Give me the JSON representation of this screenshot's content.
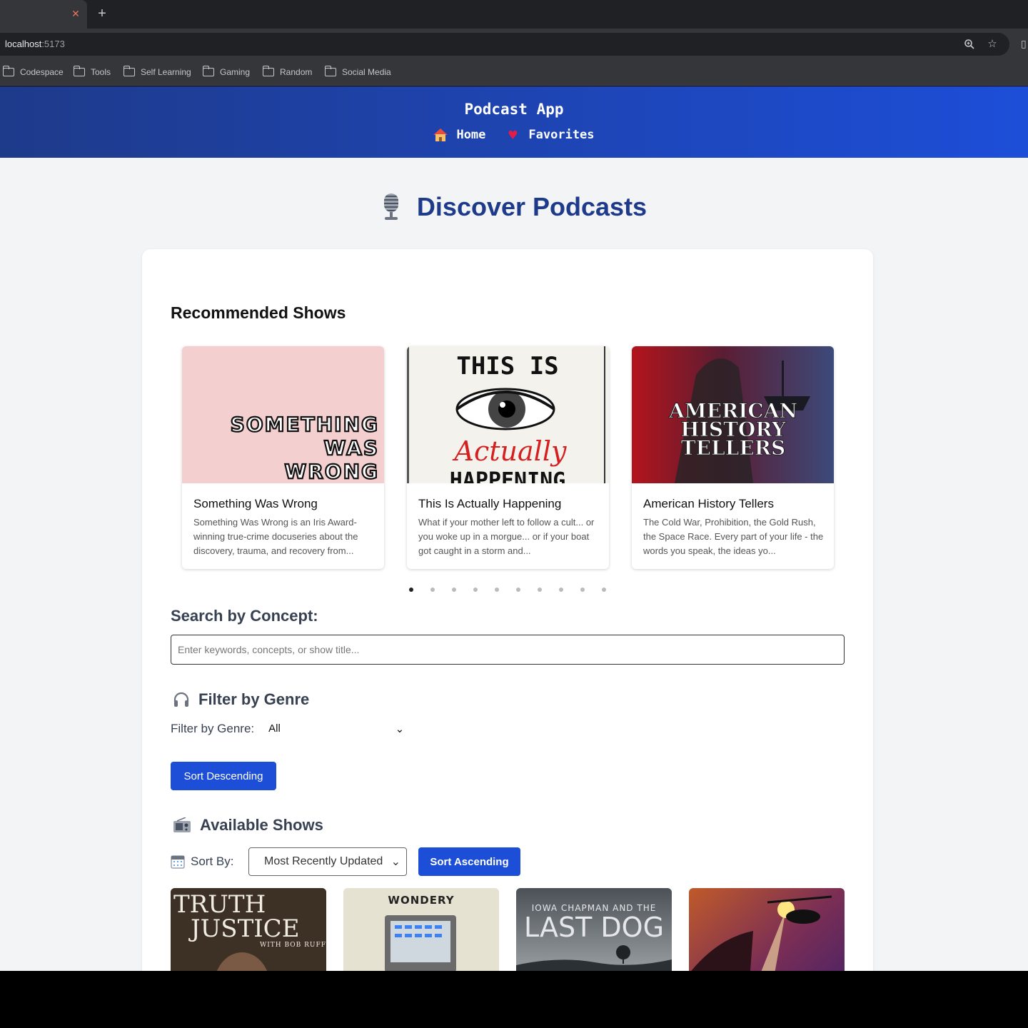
{
  "browser": {
    "url_host": "localhost",
    "url_port": ":5173",
    "bookmarks": [
      "Codespace",
      "Tools",
      "Self Learning",
      "Gaming",
      "Random",
      "Social Media"
    ]
  },
  "header": {
    "title": "Podcast App",
    "nav": [
      {
        "icon": "house-icon",
        "label": "Home"
      },
      {
        "icon": "heart-icon",
        "label": "Favorites"
      }
    ]
  },
  "page": {
    "title": "Discover Podcasts"
  },
  "recommended": {
    "heading": "Recommended Shows",
    "shows": [
      {
        "title": "Something Was Wrong",
        "description": "Something Was Wrong is an Iris Award-winning true-crime docuseries about the discovery, trauma, and recovery from...",
        "art_text": [
          "SOMETHING",
          "WAS",
          "WRONG"
        ]
      },
      {
        "title": "This Is Actually Happening",
        "description": "What if your mother left to follow a cult... or you woke up in a morgue... or if your boat got caught in a storm and...",
        "art_text": [
          "THIS IS",
          "Actually",
          "HAPPENING"
        ]
      },
      {
        "title": "American History Tellers",
        "description": "The Cold War, Prohibition, the Gold Rush, the Space Race. Every part of your life - the words you speak, the ideas yo...",
        "art_text": [
          "AMERICAN",
          "HISTORY",
          "TELLERS"
        ]
      }
    ],
    "dot_count": 10,
    "active_dot": 0
  },
  "search": {
    "heading": "Search by Concept:",
    "placeholder": "Enter keywords, concepts, or show title...",
    "value": ""
  },
  "filter": {
    "heading": "Filter by Genre",
    "label": "Filter by Genre:",
    "selected": "All",
    "sort_button": "Sort Descending"
  },
  "available": {
    "heading": "Available Shows",
    "sort_label": "Sort By:",
    "sort_selected": "Most Recently Updated",
    "sort_button": "Sort Ascending",
    "tiles": [
      {
        "art_text": [
          "TRUTH",
          "JUSTICE",
          "WITH BOB RUFF"
        ]
      },
      {
        "art_text": [
          "WONDERY"
        ]
      },
      {
        "art_text": [
          "IOWA CHAPMAN AND THE",
          "LAST DOG"
        ]
      },
      {
        "art_text": []
      }
    ]
  },
  "colors": {
    "header_start": "#1e3a8a",
    "header_end": "#1d4ed8",
    "title_blue": "#1e3a8a",
    "button_blue": "#1d4ed8",
    "page_bg": "#f3f4f6"
  }
}
